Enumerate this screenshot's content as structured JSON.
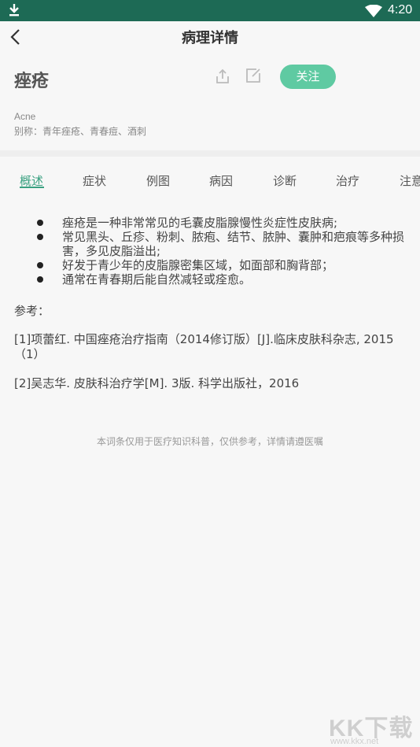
{
  "status_bar": {
    "time": "4:20"
  },
  "header": {
    "title": "病理详情"
  },
  "disease": {
    "name": "痤疮",
    "english": "Acne",
    "alias": "别称：青年痤疮、青春痘、酒刺",
    "follow_label": "关注"
  },
  "tabs": [
    {
      "label": "概述",
      "active": true
    },
    {
      "label": "症状"
    },
    {
      "label": "例图"
    },
    {
      "label": "病因"
    },
    {
      "label": "诊断"
    },
    {
      "label": "治疗"
    },
    {
      "label": "注意"
    }
  ],
  "overview": {
    "bullets": [
      "痤疮是一种非常常见的毛囊皮脂腺慢性炎症性皮肤病;",
      "常见黑头、丘疹、粉刺、脓疱、结节、脓肿、囊肿和疤痕等多种损害，多见皮脂溢出;",
      "好发于青少年的皮脂腺密集区域，如面部和胸背部；",
      "通常在青春期后能自然减轻或痊愈。"
    ],
    "ref_title": "参考：",
    "refs": [
      "[1]项蕾红. 中国痤疮治疗指南（2014修订版）[J].临床皮肤科杂志, 2015（1）",
      "[2]吴志华. 皮肤科治疗学[M]. 3版. 科学出版社，2016"
    ],
    "disclaimer": "本词条仅用于医疗知识科普，仅供参考，详情请遵医嘱"
  },
  "watermark": {
    "main": "KK下载",
    "url": "www.kkx.net"
  },
  "colors": {
    "status_bar": "#1d6a55",
    "accent": "#3aa181",
    "follow_button": "#5fcaa2"
  }
}
